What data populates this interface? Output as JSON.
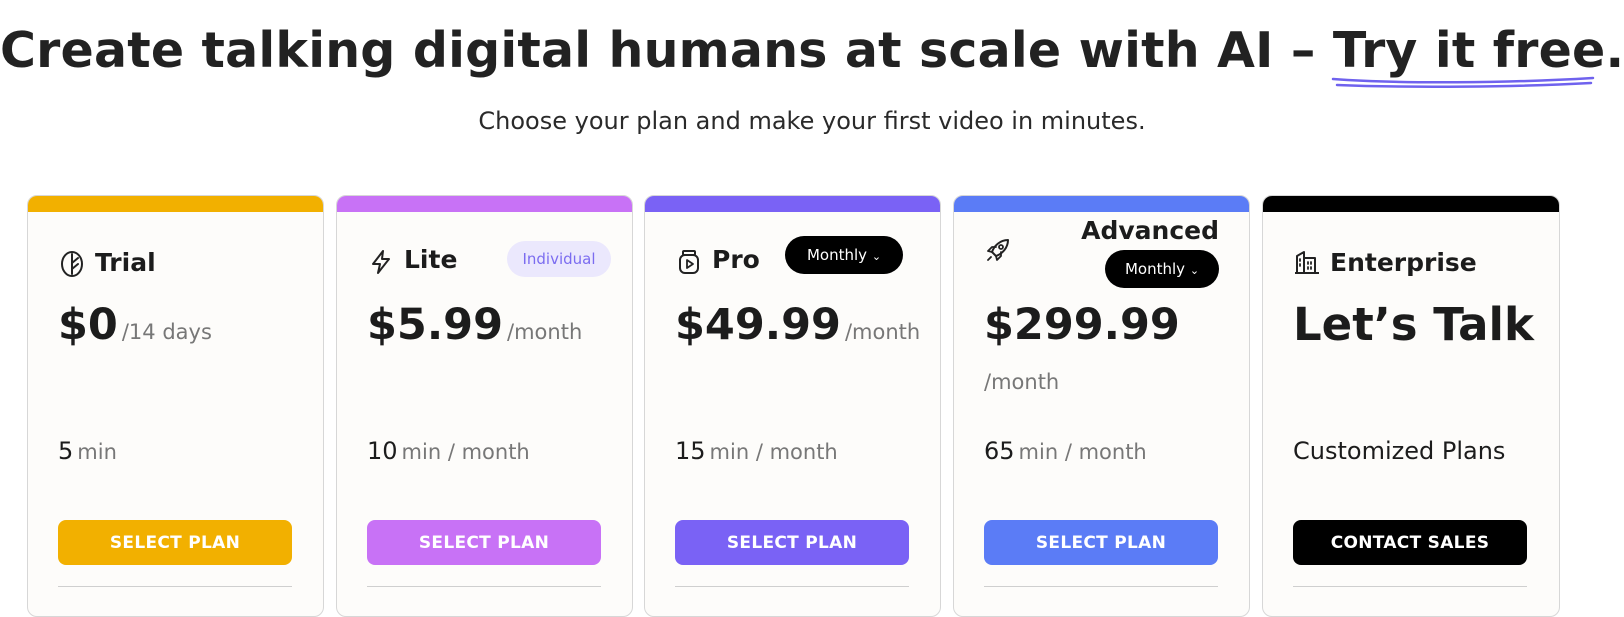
{
  "headline": {
    "text": "Create talking digital humans at scale with AI – ",
    "link": "Try it free."
  },
  "subtitle": "Choose your plan and make your first video in minutes.",
  "plans": [
    {
      "name": "Trial",
      "icon": "leaf-icon",
      "accent": "#f2b000",
      "price": "$0",
      "period": "/14 days",
      "minutes": "5",
      "minutes_unit": "min",
      "cta": "SELECT PLAN"
    },
    {
      "name": "Lite",
      "icon": "lightning-icon",
      "accent": "#c872f6",
      "badge": "Individual",
      "price": "$5.99",
      "period": "/month",
      "minutes": "10",
      "minutes_unit": "min / month",
      "cta": "SELECT PLAN"
    },
    {
      "name": "Pro",
      "icon": "video-jar-icon",
      "accent": "#7a62f5",
      "billing": "Monthly",
      "price": "$49.99",
      "period": "/month",
      "minutes": "15",
      "minutes_unit": "min / month",
      "cta": "SELECT PLAN"
    },
    {
      "name": "Advanced",
      "icon": "rocket-icon",
      "accent": "#5b7cf6",
      "billing": "Monthly",
      "price": "$299.99",
      "period": "/month",
      "minutes": "65",
      "minutes_unit": "min / month",
      "cta": "SELECT PLAN"
    },
    {
      "name": "Enterprise",
      "icon": "buildings-icon",
      "accent": "#000000",
      "price": "Let’s Talk",
      "minutes": "Customized Plans",
      "cta": "CONTACT SALES"
    }
  ]
}
